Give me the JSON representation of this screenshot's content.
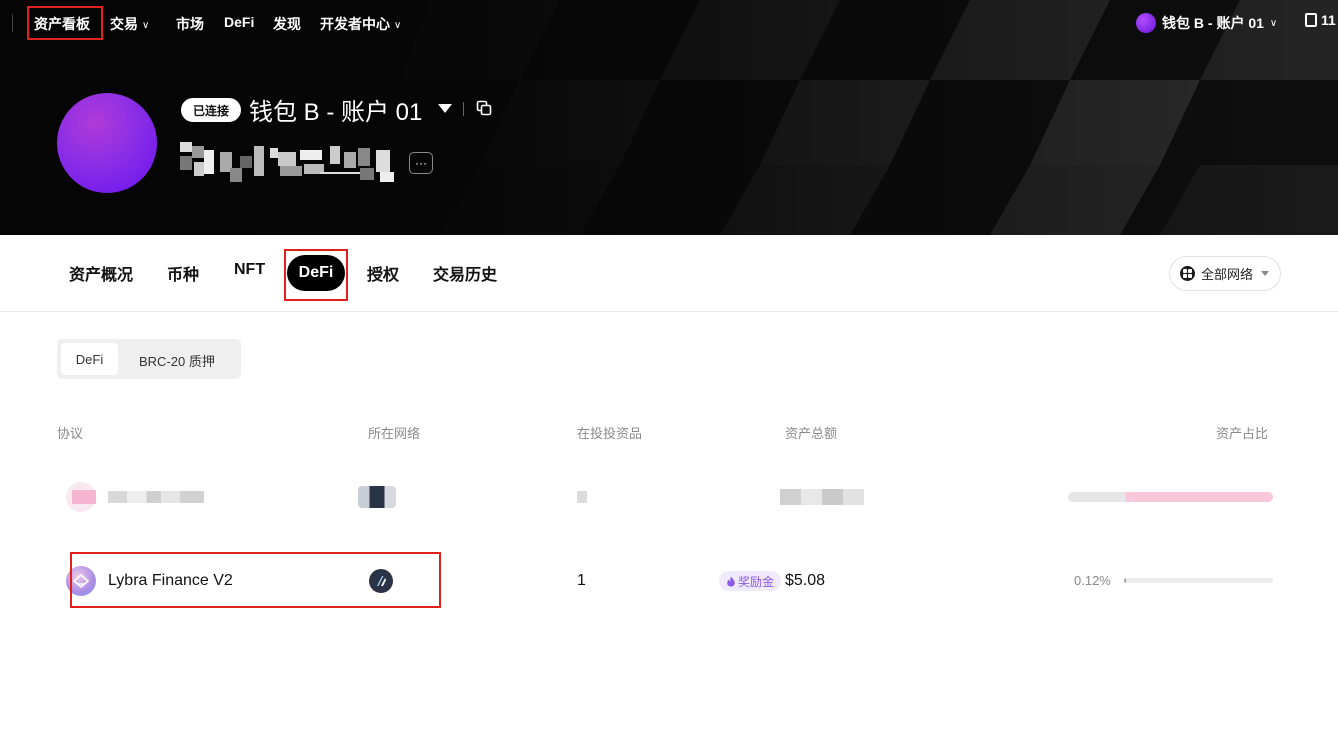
{
  "topnav": {
    "items": [
      {
        "label": "资产看板"
      },
      {
        "label": "交易"
      },
      {
        "label": "市场"
      },
      {
        "label": "DeFi"
      },
      {
        "label": "发现"
      },
      {
        "label": "开发者中心"
      }
    ],
    "account_label": "钱包 B - 账户 01",
    "extra_label": "11"
  },
  "profile": {
    "status_badge": "已连接",
    "wallet_name": "钱包 B - 账户 01",
    "more_label": "···"
  },
  "tabs": [
    {
      "label": "资产概况"
    },
    {
      "label": "币种"
    },
    {
      "label": "NFT"
    },
    {
      "label": "DeFi"
    },
    {
      "label": "授权"
    },
    {
      "label": "交易历史"
    }
  ],
  "network_filter": {
    "label": "全部网络"
  },
  "segmented": {
    "active": "DeFi",
    "other": "BRC-20 质押"
  },
  "table": {
    "headers": {
      "protocol": "协议",
      "network": "所在网络",
      "assets": "在投投资品",
      "total": "资产总额",
      "share": "资产占比"
    },
    "rows": [
      {
        "protocol": "Lybra Finance V2",
        "assets_count": "1",
        "reward_badge": "奖励金",
        "total": "$5.08",
        "share_label": "0.12%",
        "share_fraction": 0.0012
      }
    ]
  },
  "colors": {
    "accent_highlight": "#e0201c",
    "avatar_purple": "#8a2ee6",
    "reward_purple": "#8a5ae6"
  }
}
